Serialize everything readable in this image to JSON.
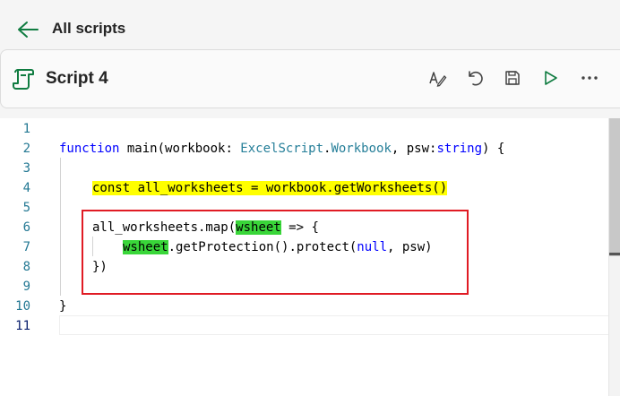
{
  "nav": {
    "back_label": "All scripts"
  },
  "script": {
    "title": "Script 4"
  },
  "toolbar": {
    "icons": [
      "rename-icon",
      "undo-icon",
      "save-icon",
      "run-icon",
      "more-icon"
    ]
  },
  "editor": {
    "line_numbers": [
      "1",
      "2",
      "3",
      "4",
      "5",
      "6",
      "7",
      "8",
      "9",
      "10",
      "11"
    ],
    "line2": {
      "kw_function": "function",
      "name_part": " main(workbook: ",
      "type_ns": "ExcelScript",
      "dot": ".",
      "type_name": "Workbook",
      "mid": ", psw:",
      "kw_string": "string",
      "end": ") {"
    },
    "line4": {
      "text": "const all_worksheets = workbook.getWorksheets()"
    },
    "line6": {
      "prefix": "all_worksheets.map(",
      "param": "wsheet",
      "suffix": " => {"
    },
    "line7": {
      "param": "wsheet",
      "mid": ".getProtection().protect(",
      "kw_null": "null",
      "end": ", psw)"
    },
    "line8": {
      "text": "})"
    },
    "line10": {
      "text": "}"
    },
    "highlight_colors": {
      "yellow": "#ffff00",
      "green": "#39d639",
      "box": "#e01b24"
    }
  },
  "accent": "#107c41"
}
